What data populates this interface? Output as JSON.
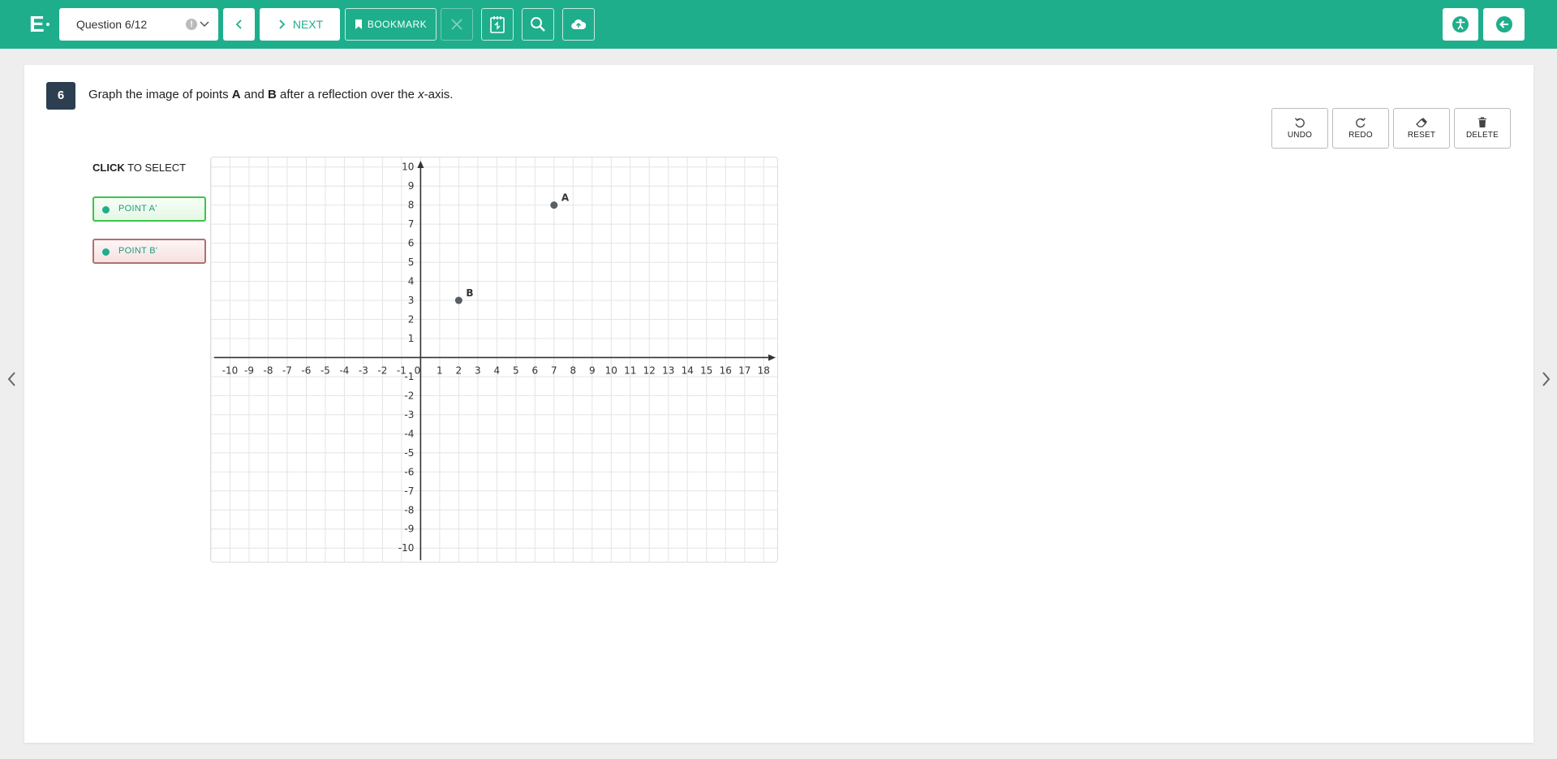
{
  "header": {
    "logo": "E",
    "question_selector": "Question 6/12",
    "flag_icon": "!",
    "next_label": "NEXT",
    "bookmark_label": "BOOKMARK",
    "accent_color": "#1fae8b"
  },
  "question": {
    "number": "6",
    "prompt_parts": {
      "p1": "Graph the image of points ",
      "a": "A",
      "p2": " and ",
      "b": "B",
      "p3": " after a reflection over the ",
      "axis": "x",
      "p4": "-axis."
    }
  },
  "tools": {
    "undo": "UNDO",
    "redo": "REDO",
    "reset": "RESET",
    "delete": "DELETE"
  },
  "selector": {
    "title_bold": "CLICK",
    "title_rest": " TO SELECT",
    "point_a": "POINT A'",
    "point_b": "POINT B'"
  },
  "chart_data": {
    "type": "scatter",
    "xlim": [
      -11,
      18.8
    ],
    "ylim": [
      -10.8,
      10.5
    ],
    "x_ticks": [
      -10,
      -9,
      -8,
      -7,
      -6,
      -5,
      -4,
      -3,
      -2,
      -1,
      1,
      2,
      3,
      4,
      5,
      6,
      7,
      8,
      9,
      10,
      11,
      12,
      13,
      14,
      15,
      16,
      17,
      18
    ],
    "y_ticks": [
      -10,
      -9,
      -8,
      -7,
      -6,
      -5,
      -4,
      -3,
      -2,
      -1,
      1,
      2,
      3,
      4,
      5,
      6,
      7,
      8,
      9,
      10
    ],
    "origin_label": "0",
    "grid": true,
    "points": [
      {
        "label": "A",
        "x": 7,
        "y": 8
      },
      {
        "label": "B",
        "x": 2,
        "y": 3
      }
    ]
  }
}
